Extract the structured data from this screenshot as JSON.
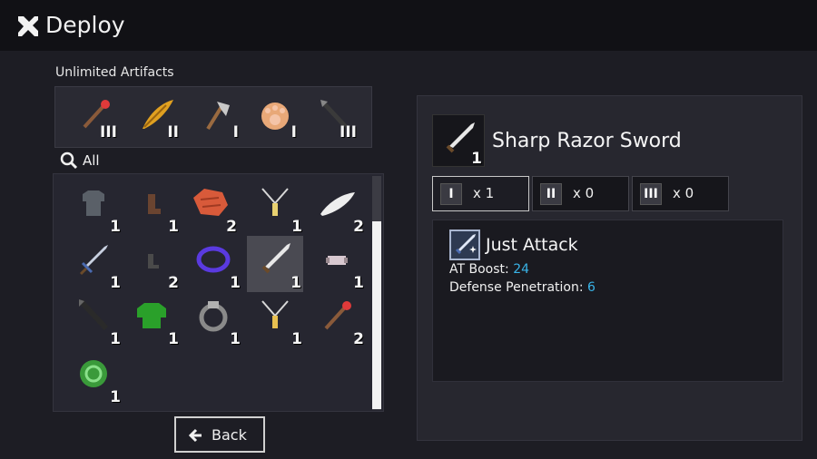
{
  "header": {
    "title": "Deploy",
    "icon": "crossed-swords-icon"
  },
  "unlimited": {
    "label": "Unlimited Artifacts",
    "items": [
      {
        "name": "ruby-wand-icon",
        "count": "III"
      },
      {
        "name": "golden-feather-icon",
        "count": "II"
      },
      {
        "name": "axe-icon",
        "count": "I"
      },
      {
        "name": "cat-paw-icon",
        "count": "I"
      },
      {
        "name": "dark-spear-icon",
        "count": "III"
      }
    ]
  },
  "filter": {
    "label": "All",
    "icon": "search-icon"
  },
  "inventory": {
    "rows": [
      [
        {
          "name": "chainmail-icon",
          "count": "1"
        },
        {
          "name": "leather-boot-icon",
          "count": "1"
        },
        {
          "name": "meat-steak-icon",
          "count": "2"
        },
        {
          "name": "silver-necklace-icon",
          "count": "1"
        },
        {
          "name": "white-feather-icon",
          "count": "2"
        }
      ],
      [
        {
          "name": "short-sword-icon",
          "count": "1"
        },
        {
          "name": "dark-boot-icon",
          "count": "2"
        },
        {
          "name": "purple-ring-icon",
          "count": "1"
        },
        {
          "name": "razor-sword-icon",
          "count": "1",
          "selected": true
        },
        {
          "name": "bracer-icon",
          "count": "1"
        }
      ],
      [
        {
          "name": "black-spear-icon",
          "count": "1"
        },
        {
          "name": "green-tunic-icon",
          "count": "1"
        },
        {
          "name": "iron-ring-icon",
          "count": "1"
        },
        {
          "name": "gold-necklace-icon",
          "count": "1"
        },
        {
          "name": "red-wand-icon",
          "count": "2"
        }
      ],
      [
        {
          "name": "green-orb-icon",
          "count": "1"
        }
      ]
    ],
    "scroll_position": 0.19
  },
  "back_button": {
    "label": "Back"
  },
  "detail": {
    "item_name": "Sharp Razor Sword",
    "item_count": "1",
    "tiers": [
      {
        "badge": "I",
        "qty": "x 1",
        "active": true
      },
      {
        "badge": "II",
        "qty": "x 0",
        "active": false
      },
      {
        "badge": "III",
        "qty": "x 0",
        "active": false
      }
    ],
    "skill": {
      "name": "Just Attack",
      "stats": [
        {
          "label": "AT Boost:",
          "value": "24"
        },
        {
          "label": "Defense Penetration:",
          "value": "6"
        }
      ]
    }
  },
  "colors": {
    "background": "#1d1d24",
    "panel": "#27272f",
    "stat_value": "#39b4e8"
  }
}
